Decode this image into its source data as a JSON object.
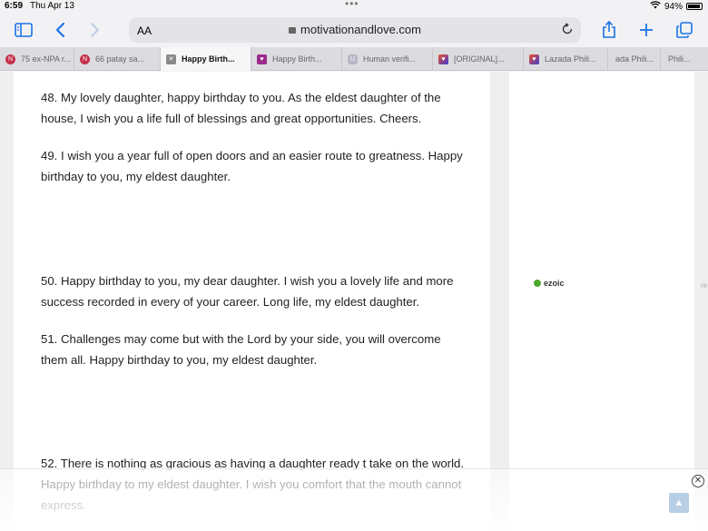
{
  "status": {
    "time": "6:59",
    "date": "Thu Apr 13",
    "battery": "94%"
  },
  "toolbar": {
    "aa_label": "AA",
    "url": "motivationandlove.com"
  },
  "tabs": [
    {
      "label": "75 ex-NPA r..."
    },
    {
      "label": "66 patay sa..."
    },
    {
      "label": "Happy Birth..."
    },
    {
      "label": "Happy Birth..."
    },
    {
      "label": "Human verifi..."
    },
    {
      "label": "[ORIGINAL]..."
    },
    {
      "label": "Lazada Phili..."
    },
    {
      "label": "ada Phili..."
    },
    {
      "label": "Phili..."
    }
  ],
  "article": {
    "paragraphs": [
      "48. My lovely daughter, happy birthday to you. As the eldest daughter of the house, I wish you a life full of blessings and great opportunities. Cheers.",
      "49. I wish you a year full of open doors and an easier route to greatness. Happy birthday to you, my eldest daughter.",
      "50. Happy birthday to you, my dear daughter. I wish you a lovely life and more success recorded in every of your career. Long life, my eldest daughter.",
      "51. Challenges may come but with the Lord by your side, you will overcome them all. Happy birthday to you, my eldest daughter.",
      "52. There is nothing as gracious as having a daughter ready t take on the world. Happy birthday to my eldest daughter. I wish you comfort that the mouth cannot express."
    ]
  },
  "sidebar": {
    "ezoic_label": "ezoic",
    "edge_text": "re"
  },
  "colors": {
    "accent": "#1a73e8",
    "favicon_red": "#c6304a"
  }
}
